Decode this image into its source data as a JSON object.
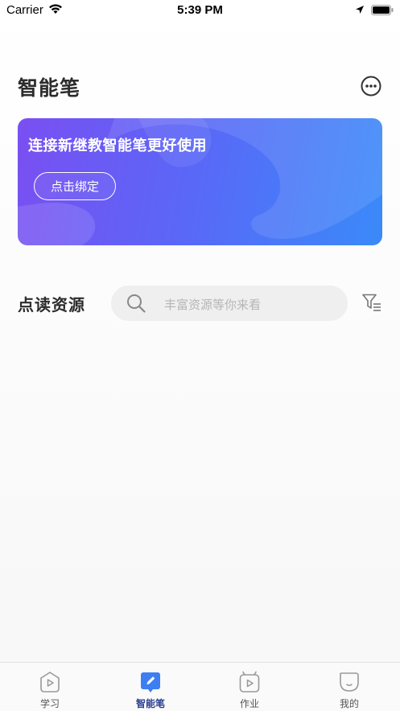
{
  "status_bar": {
    "carrier": "Carrier",
    "time": "5:39 PM"
  },
  "header": {
    "title": "智能笔"
  },
  "banner": {
    "title": "连接新继教智能笔更好使用",
    "button_label": "点击绑定"
  },
  "resources": {
    "title": "点读资源",
    "search_placeholder": "丰富资源等你来看"
  },
  "tabbar": {
    "tabs": [
      {
        "label": "学习",
        "icon": "study-icon",
        "active": false
      },
      {
        "label": "智能笔",
        "icon": "pen-icon",
        "active": true
      },
      {
        "label": "作业",
        "icon": "homework-icon",
        "active": false
      },
      {
        "label": "我的",
        "icon": "profile-icon",
        "active": false
      }
    ]
  },
  "colors": {
    "accent": "#2a3f8f",
    "banner_start": "#7a4ff2",
    "banner_end": "#3a8af9"
  }
}
